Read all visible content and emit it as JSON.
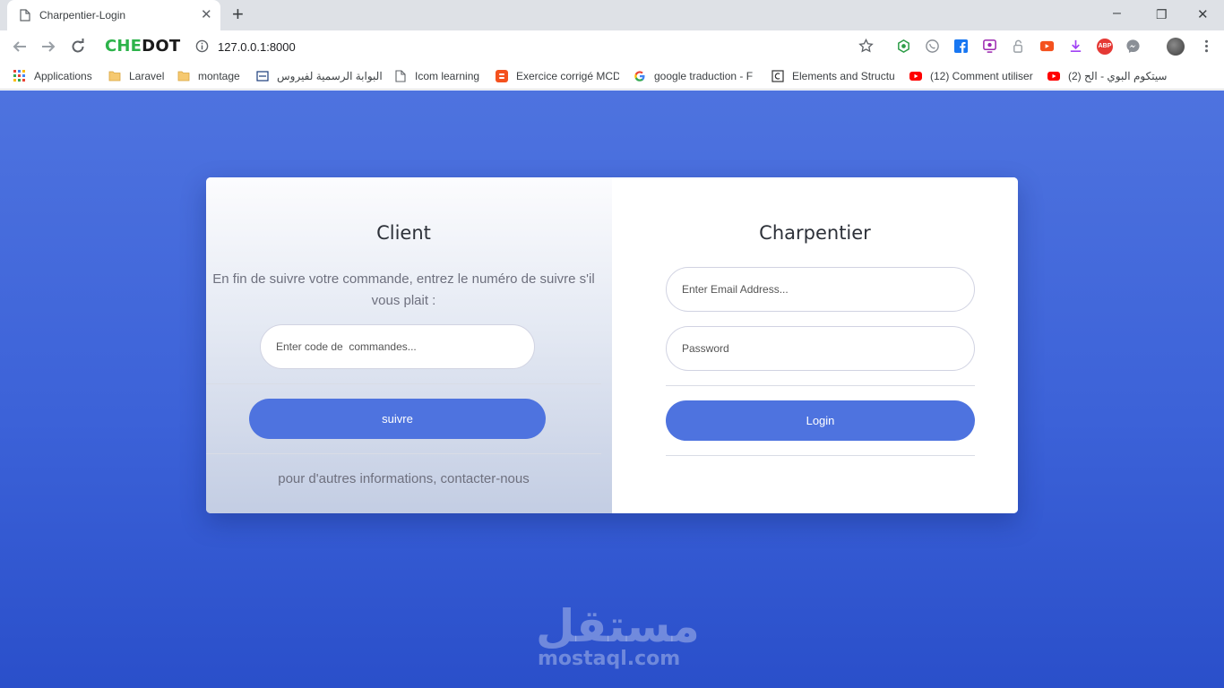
{
  "browser": {
    "tab_title": "Charpentier-Login",
    "new_tab_label": "+",
    "close_tab_label": "✕",
    "brand_part1": "CHE",
    "brand_part2": "DOT",
    "url": "127.0.0.1:8000",
    "window_controls": {
      "minimize": "–",
      "restore": "❐",
      "close": "✕"
    },
    "extension_icons": [
      "star-icon",
      "puzzle-icon",
      "whatsapp-icon",
      "facebook-icon",
      "screen-icon",
      "lock-icon",
      "video-icon",
      "download-icon",
      "adblock-icon",
      "messenger-icon",
      "avatar-icon",
      "menu-icon"
    ],
    "adblock_text": "ABP",
    "bookmarks": [
      {
        "label": "Applications",
        "icon": "apps-grid-icon"
      },
      {
        "label": "Laravel",
        "icon": "folder-icon"
      },
      {
        "label": "montage",
        "icon": "folder-icon"
      },
      {
        "label": "البوابة الرسمية لفيروس",
        "icon": "site-icon"
      },
      {
        "label": "Icom learning",
        "icon": "page-icon"
      },
      {
        "label": "Exercice corrigé MCD",
        "icon": "blogger-icon"
      },
      {
        "label": "google traduction - F",
        "icon": "google-icon"
      },
      {
        "label": "Elements and Structu",
        "icon": "c-icon"
      },
      {
        "label": "(12) Comment utiliser",
        "icon": "youtube-icon"
      },
      {
        "label": "(2) سيتكوم البوي - الح",
        "icon": "youtube-icon"
      }
    ],
    "colors": {
      "brand_green": "#2db34a",
      "youtube_red": "#ff0000"
    }
  },
  "client": {
    "title": "Client",
    "description": "En fin de suivre votre commande, entrez le numéro de suivre s'il vous plait :",
    "code_placeholder": "Enter code de  commandes...",
    "submit_label": "suivre",
    "contact_text": "pour d'autres informations, contacter-nous"
  },
  "charpentier": {
    "title": "Charpentier",
    "email_placeholder": "Enter Email Address...",
    "password_placeholder": "Password",
    "login_label": "Login"
  },
  "watermark": {
    "arabic": "مستقل",
    "latin": "mostaql.com"
  },
  "theme": {
    "primary": "#4e73df",
    "background_gradient": [
      "#4e73df",
      "#2a4fca"
    ]
  }
}
